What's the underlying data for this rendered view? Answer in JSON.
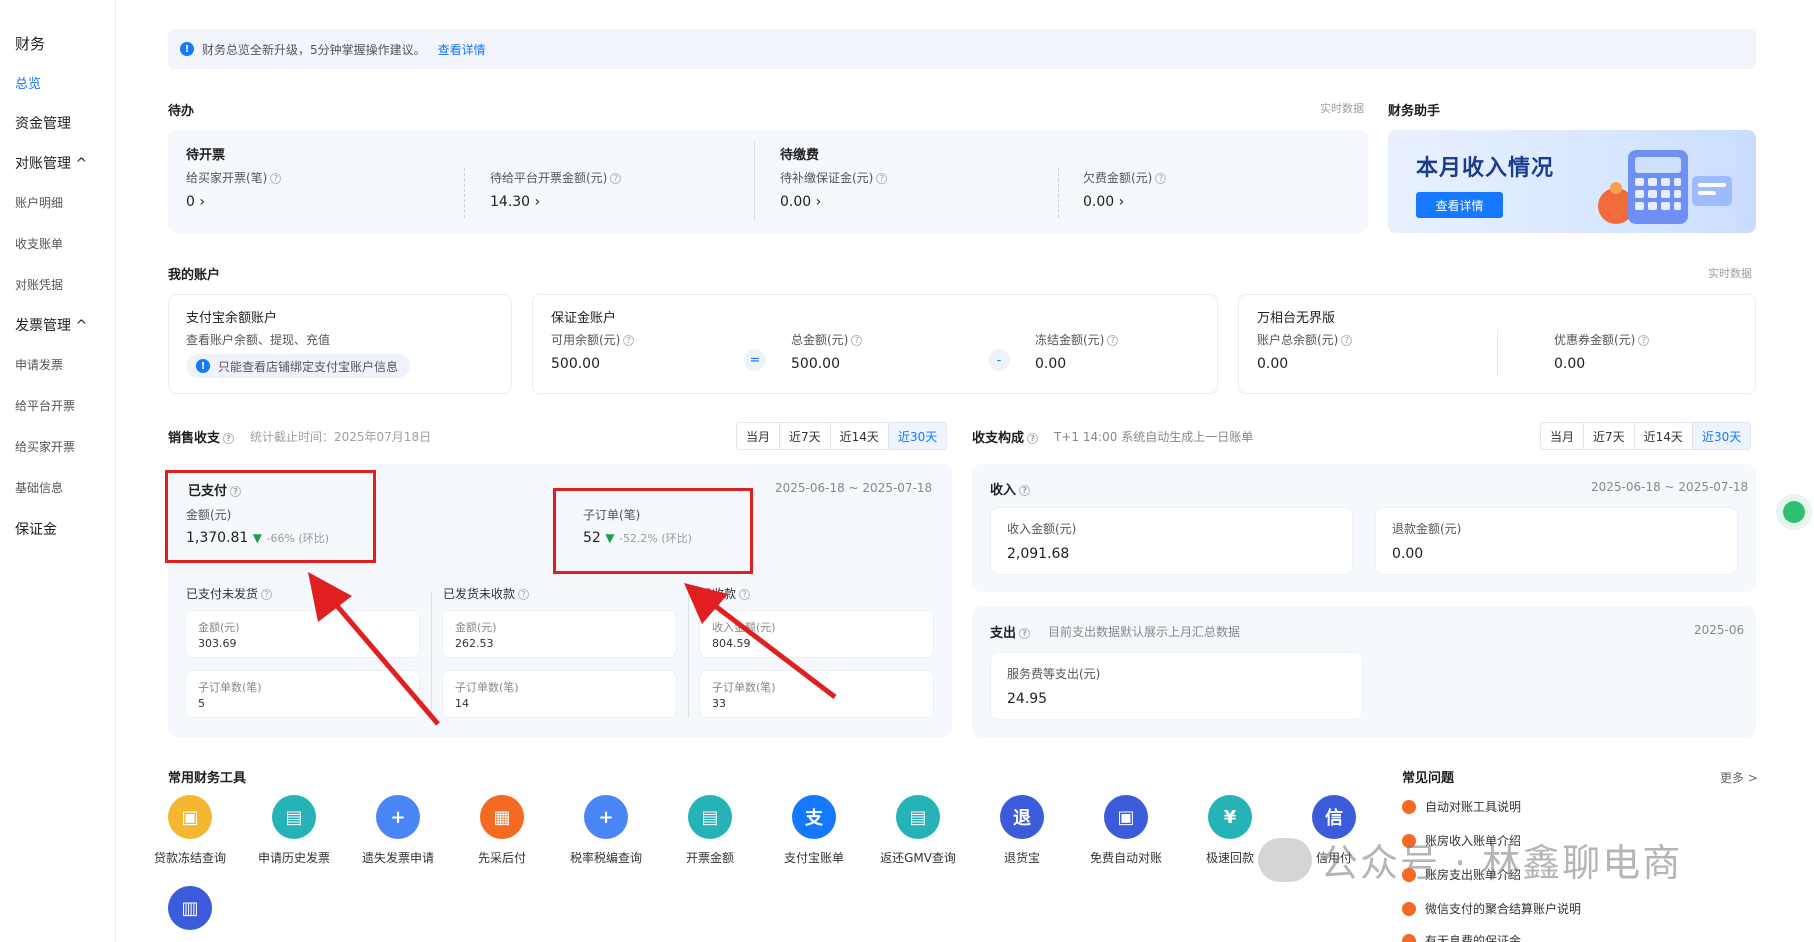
{
  "sidebar": {
    "title": "财务",
    "items": [
      "总览",
      "资金管理",
      "对账管理 ^",
      "账户明细",
      "收支账单",
      "对账凭据",
      "发票管理 ^",
      "申请发票",
      "给平台开票",
      "给买家开票",
      "基础信息",
      "保证金"
    ]
  },
  "notice": {
    "text": "财务总览全新升级，5分钟掌握操作建议。",
    "link": "查看详情"
  },
  "todo": {
    "title": "待办",
    "realtime": "实时数据",
    "invoice_group": "待开票",
    "buyer_invoice_label": "给买家开票(笔)",
    "buyer_invoice_value": "0 ›",
    "platform_invoice_label": "待给平台开票金额(元)",
    "platform_invoice_value": "14.30 ›",
    "fee_group": "待缴费",
    "deposit_label": "待补缴保证金(元)",
    "deposit_value": "0.00 ›",
    "owed_label": "欠费金额(元)",
    "owed_value": "0.00 ›"
  },
  "assistant": {
    "title": "财务助手",
    "banner_title": "本月收入情况",
    "banner_button": "查看详情"
  },
  "accounts": {
    "title": "我的账户",
    "realtime": "实时数据",
    "alipay": {
      "title": "支付宝余额账户",
      "desc": "查看账户余额、提现、充值",
      "tip": "只能查看店铺绑定支付宝账户信息"
    },
    "deposit": {
      "title": "保证金账户",
      "available_label": "可用余额(元)",
      "available_value": "500.00",
      "eq": "=",
      "total_label": "总金额(元)",
      "total_value": "500.00",
      "minus": "-",
      "frozen_label": "冻结金额(元)",
      "frozen_value": "0.00"
    },
    "wanxiang": {
      "title": "万相台无界版",
      "balance_label": "账户总余额(元)",
      "balance_value": "0.00",
      "coupon_label": "优惠券金额(元)",
      "coupon_value": "0.00"
    }
  },
  "sales": {
    "title": "销售收支",
    "stat_time": "统计截止时间：2025年07月18日",
    "tabs": [
      "当月",
      "近7天",
      "近14天",
      "近30天"
    ],
    "active_tab": "近30天",
    "date_range": "2025-06-18 ~ 2025-07-18",
    "paid_title": "已支付",
    "amount_label": "金额(元)",
    "amount_value": "1,370.81",
    "amount_change": "▼",
    "amount_pct": "-66% (环比)",
    "orders_label": "子订单(笔)",
    "orders_value": "52",
    "orders_change": "▼",
    "orders_pct": "-52.2% (环比)",
    "sub": [
      {
        "title": "已支付未发货",
        "amt_label": "金额(元)",
        "amt": "303.69",
        "cnt_label": "子订单数(笔)",
        "cnt": "5"
      },
      {
        "title": "已发货未收款",
        "amt_label": "金额(元)",
        "amt": "262.53",
        "cnt_label": "子订单数(笔)",
        "cnt": "14"
      },
      {
        "title": "已收款",
        "amt_label": "收入金额(元)",
        "amt": "804.59",
        "cnt_label": "子订单数(笔)",
        "cnt": "33"
      }
    ]
  },
  "composition": {
    "title": "收支构成",
    "note": "T+1 14:00 系统自动生成上一日账单",
    "tabs": [
      "当月",
      "近7天",
      "近14天",
      "近30天"
    ],
    "active_tab": "近30天",
    "income_title": "收入",
    "income_range": "2025-06-18 ~ 2025-07-18",
    "income_label": "收入金额(元)",
    "income_value": "2,091.68",
    "refund_label": "退款金额(元)",
    "refund_value": "0.00",
    "expense_title": "支出",
    "expense_note": "目前支出数据默认展示上月汇总数据",
    "expense_month": "2025-06",
    "service_label": "服务费等支出(元)",
    "service_value": "24.95"
  },
  "tools": {
    "title": "常用财务工具",
    "items": [
      {
        "label": "贷款冻结查询",
        "color": "#f5b731",
        "glyph": "▣"
      },
      {
        "label": "申请历史发票",
        "color": "#26b3b8",
        "glyph": "▤"
      },
      {
        "label": "遗失发票申请",
        "color": "#4a86f5",
        "glyph": "+"
      },
      {
        "label": "先采后付",
        "color": "#f46a22",
        "glyph": "▦"
      },
      {
        "label": "税率税编查询",
        "color": "#4a86f5",
        "glyph": "+"
      },
      {
        "label": "开票金额",
        "color": "#26b3b8",
        "glyph": "▤"
      },
      {
        "label": "支付宝账单",
        "color": "#1677ff",
        "glyph": "支"
      },
      {
        "label": "返还GMV查询",
        "color": "#26b3b8",
        "glyph": "▤"
      },
      {
        "label": "退货宝",
        "color": "#3b5bdb",
        "glyph": "退"
      },
      {
        "label": "免费自动对账",
        "color": "#3b5bdb",
        "glyph": "▣"
      },
      {
        "label": "极速回款",
        "color": "#26b3b8",
        "glyph": "¥"
      },
      {
        "label": "信用付",
        "color": "#3b5bdb",
        "glyph": "信"
      },
      {
        "label": "",
        "color": "#3b5bdb",
        "glyph": "▥"
      }
    ]
  },
  "faq": {
    "title": "常见问题",
    "more": "更多 >",
    "items": [
      "自动对账工具说明",
      "账房收入账单介绍",
      "账房支出账单介绍",
      "微信支付的聚合结算账户说明",
      "有无息费的保证金"
    ]
  },
  "watermark": "公众号 · 林鑫聊电商",
  "colors": {
    "accent": "#1677ff",
    "annotation": "#e02020",
    "down": "#21a04a"
  }
}
